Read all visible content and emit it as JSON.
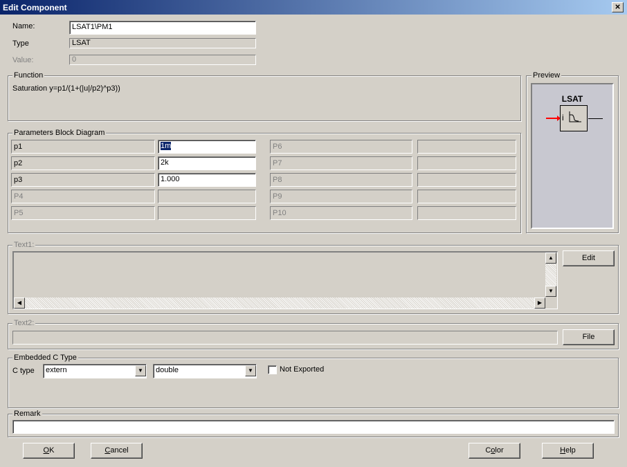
{
  "window": {
    "title": "Edit Component",
    "close_glyph": "×"
  },
  "fields": {
    "name_label": "Name:",
    "name_value": "LSAT1\\PM1",
    "type_label": "Type",
    "type_value": "LSAT",
    "value_label": "Value:",
    "value_value": "0"
  },
  "function": {
    "title": "Function",
    "text": "Saturation y=p1/(1+(|u|/p2)^p3))"
  },
  "preview": {
    "title": "Preview",
    "block_name": "LSAT",
    "input_label": "i",
    "colors": {
      "background": "#c8c8d0",
      "wire": "#ff0000"
    }
  },
  "params": {
    "title": "Parameters Block Diagram",
    "left": [
      {
        "label": "p1",
        "value": "1m",
        "enabled": true,
        "selected": true
      },
      {
        "label": "p2",
        "value": "2k",
        "enabled": true,
        "selected": false
      },
      {
        "label": "p3",
        "value": "1.000",
        "enabled": true,
        "selected": false
      },
      {
        "label": "P4",
        "value": "",
        "enabled": false,
        "selected": false
      },
      {
        "label": "P5",
        "value": "",
        "enabled": false,
        "selected": false
      }
    ],
    "right": [
      {
        "label": "P6",
        "value": ""
      },
      {
        "label": "P7",
        "value": ""
      },
      {
        "label": "P8",
        "value": ""
      },
      {
        "label": "P9",
        "value": ""
      },
      {
        "label": "P10",
        "value": ""
      }
    ]
  },
  "text1": {
    "title": "Text1:",
    "value": "",
    "edit_button": "Edit"
  },
  "text2": {
    "title": "Text2:",
    "value": "",
    "file_button": "File"
  },
  "embedded": {
    "title": "Embedded C Type",
    "ctype_label": "C type",
    "storage_value": "extern",
    "datatype_value": "double",
    "not_exported_label": "Not Exported",
    "not_exported_checked": false
  },
  "remark": {
    "title": "Remark",
    "value": ""
  },
  "buttons": {
    "ok_mnemonic": "O",
    "ok_rest": "K",
    "cancel_mnemonic": "C",
    "cancel_rest": "ancel",
    "color_pre": "C",
    "color_mnemonic": "o",
    "color_rest": "lor",
    "help_mnemonic": "H",
    "help_rest": "elp"
  },
  "icons": {
    "combo_arrow": "▼",
    "scroll_up": "▲",
    "scroll_down": "▼",
    "scroll_left": "◀",
    "scroll_right": "▶"
  }
}
